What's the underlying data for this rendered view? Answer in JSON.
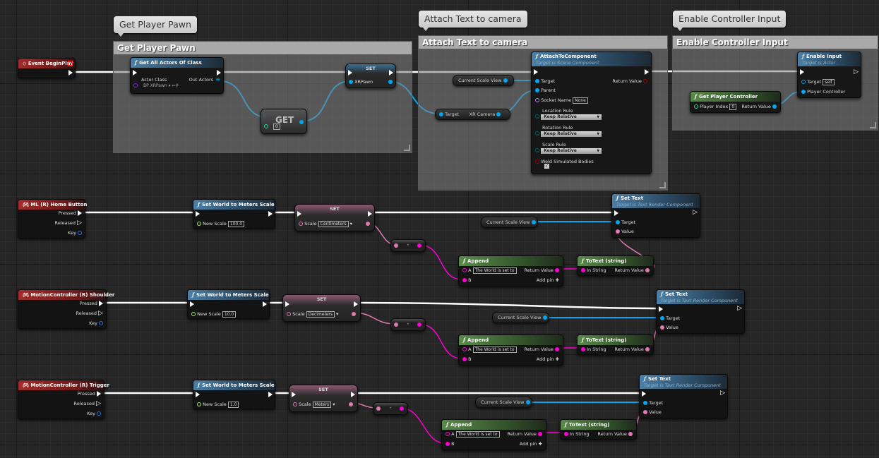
{
  "comments": [
    {
      "bubble": "Get Player Pawn",
      "title": "Get Player Pawn"
    },
    {
      "bubble": "Attach Text to camera",
      "title": "Attach Text to camera"
    },
    {
      "bubble": "Enable Controller Input",
      "title": "Enable Controller Input"
    }
  ],
  "begin_play": {
    "title": "Event BeginPlay"
  },
  "get_all_actors": {
    "title": "Get All Actors Of Class",
    "actor_class_label": "Actor Class",
    "actor_class_value": "BP XRPawn",
    "out_actors": "Out Actors"
  },
  "get_node": {
    "title": "GET",
    "index": "0"
  },
  "set_xrpawn": {
    "title": "SET",
    "pin": "XRPawn"
  },
  "current_scale_view": "Current Scale View",
  "xr_camera": {
    "target": "Target",
    "output": "XR Camera"
  },
  "attach": {
    "title": "AttachToComponent",
    "subtitle": "Target is Scene Component",
    "target": "Target",
    "parent": "Parent",
    "socket_name": "Socket Name",
    "socket_value": "None",
    "return_value": "Return Value",
    "location_rule": "Location Rule",
    "location_value": "Keep Relative",
    "rotation_rule": "Rotation Rule",
    "rotation_value": "Keep Relative",
    "scale_rule": "Scale Rule",
    "scale_value": "Keep Relative",
    "weld": "Weld Simulated Bodies",
    "weld_checked": true
  },
  "enable_input": {
    "title": "Enable Input",
    "subtitle": "Target is Actor",
    "target": "Target",
    "target_value": "self",
    "player_controller": "Player Controller"
  },
  "get_player_controller": {
    "title": "Get Player Controller",
    "player_index": "Player Index",
    "index_value": "0",
    "return_value": "Return Value"
  },
  "rows": [
    {
      "event": "ML (R) Home Button",
      "scale": "100.0",
      "unit": "Centimeters"
    },
    {
      "event": "MotionController (R) Shoulder",
      "scale": "10.0",
      "unit": "Decimeters"
    },
    {
      "event": "MotionController (R) Trigger",
      "scale": "1.0",
      "unit": "Meters"
    }
  ],
  "labels": {
    "pressed": "Pressed",
    "released": "Released",
    "key": "Key",
    "set_world_scale": "Set World to Meters Scale",
    "new_scale": "New Scale",
    "set": "SET",
    "scale": "Scale",
    "append": "Append",
    "a": "A",
    "b": "B",
    "append_a_value": "The World is set to",
    "add_pin": "Add pin",
    "return_value": "Return Value",
    "totext": "ToText (string)",
    "in_string": "In String",
    "set_text": "Set Text",
    "set_text_sub": "Target is Text Render Component",
    "target": "Target",
    "value": "Value"
  },
  "colors": {
    "exec": "#ffffff",
    "object": "#00a8f3",
    "string": "#ff00d4",
    "text": "#e07ab0",
    "float": "#9cf25e",
    "class": "#7a2cf0",
    "int": "#1fe09c",
    "bool": "#a00000",
    "name": "#c080f0",
    "byte": "#006060"
  }
}
